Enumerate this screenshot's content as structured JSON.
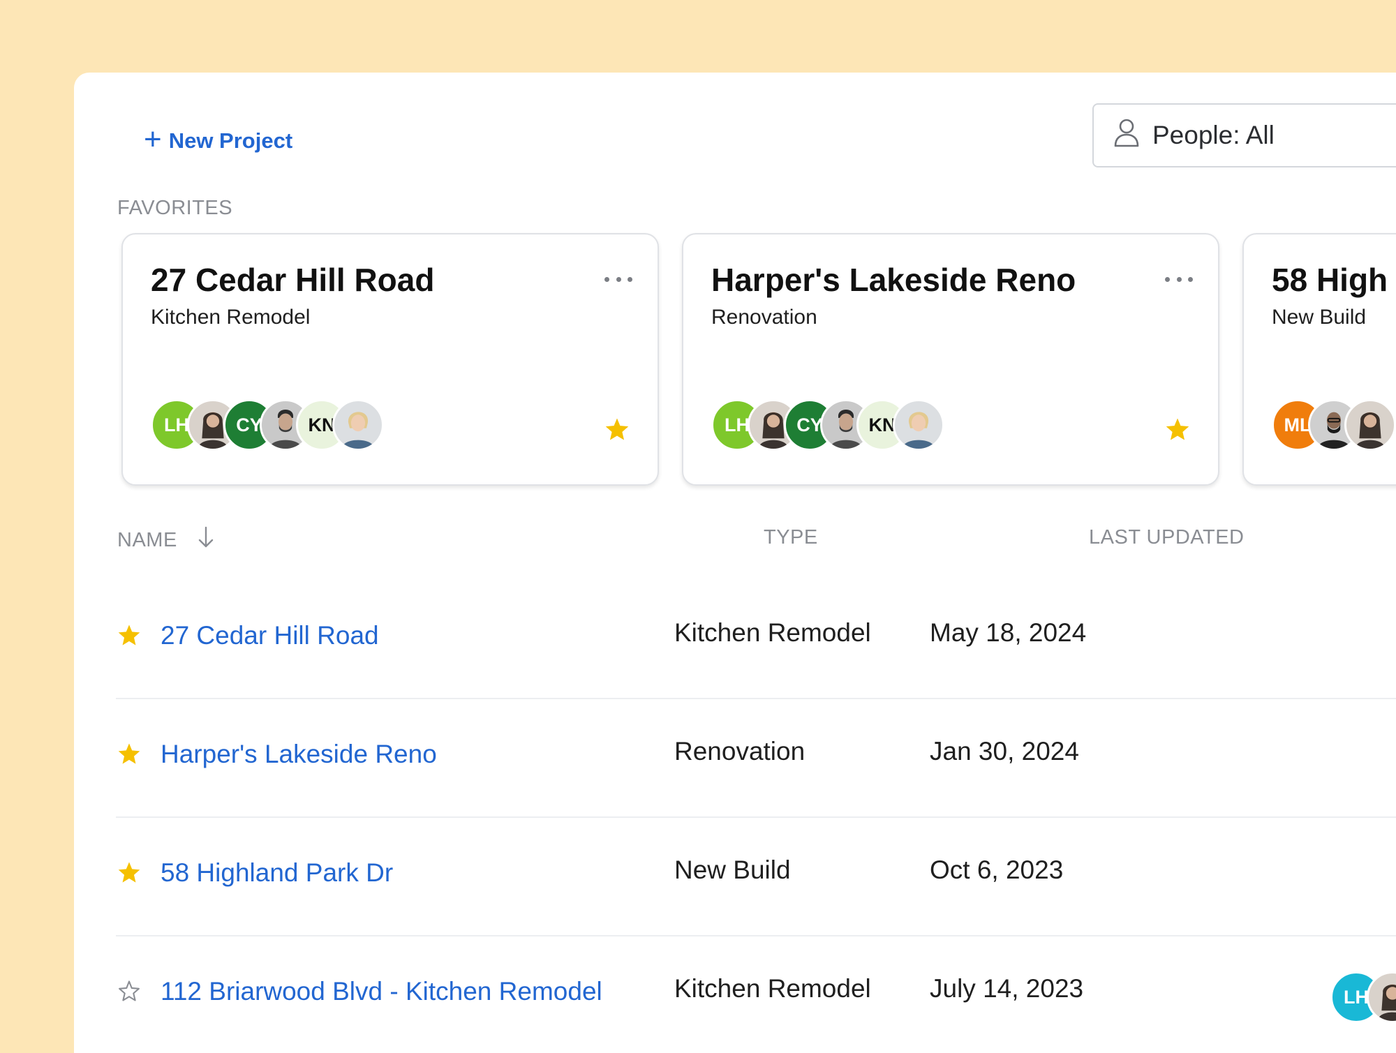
{
  "toolbar": {
    "new_project_label": "New Project",
    "people_filter_label": "People: All"
  },
  "favorites": {
    "section_label": "FAVORITES",
    "cards": [
      {
        "title": "27 Cedar Hill Road",
        "subtitle": "Kitchen Remodel",
        "starred": true,
        "avatars": [
          {
            "initials": "LH",
            "color": "#7ec82b"
          },
          {
            "photo": "woman-dark-hair",
            "color": "#d9d2cb"
          },
          {
            "initials": "CY",
            "color": "#1e7e34"
          },
          {
            "photo": "man-beard",
            "color": "#c9c9c9"
          },
          {
            "initials": "KN",
            "color": "#e9f3dd",
            "text_color": "#111111"
          },
          {
            "photo": "woman-blonde",
            "color": "#dcdfe2"
          }
        ]
      },
      {
        "title": "Harper's Lakeside Reno",
        "subtitle": "Renovation",
        "starred": true,
        "avatars": [
          {
            "initials": "LH",
            "color": "#7ec82b"
          },
          {
            "photo": "woman-dark-hair",
            "color": "#d9d2cb"
          },
          {
            "initials": "CY",
            "color": "#1e7e34"
          },
          {
            "photo": "man-beard",
            "color": "#c9c9c9"
          },
          {
            "initials": "KN",
            "color": "#e9f3dd",
            "text_color": "#111111"
          },
          {
            "photo": "woman-blonde",
            "color": "#dcdfe2"
          }
        ]
      },
      {
        "title": "58 High",
        "subtitle": "New Build",
        "starred": true,
        "avatars": [
          {
            "initials": "ML",
            "color": "#f07d0c"
          },
          {
            "photo": "man-glasses-beard",
            "color": "#cfcfcf"
          },
          {
            "photo": "woman-dark-hair",
            "color": "#d9d2cb"
          }
        ]
      }
    ]
  },
  "table": {
    "columns": {
      "name": "NAME",
      "type": "TYPE",
      "last_updated": "LAST UPDATED"
    },
    "sort": {
      "column": "name",
      "direction": "descending"
    },
    "rows": [
      {
        "name": "27 Cedar Hill Road",
        "type": "Kitchen Remodel",
        "last_updated": "May 18, 2024",
        "starred": true
      },
      {
        "name": "Harper's Lakeside Reno",
        "type": "Renovation",
        "last_updated": "Jan 30, 2024",
        "starred": true
      },
      {
        "name": "58 Highland Park Dr",
        "type": "New Build",
        "last_updated": "Oct 6, 2023",
        "starred": true
      },
      {
        "name": "112 Briarwood Blvd - Kitchen Remodel",
        "type": "Kitchen Remodel",
        "last_updated": "July 14, 2023",
        "starred": false,
        "avatars": [
          {
            "initials": "LH",
            "color": "#19b8d6"
          },
          {
            "photo": "woman-dark-hair",
            "color": "#d9d2cb"
          }
        ]
      }
    ]
  },
  "colors": {
    "accent": "#2266d1",
    "star": "#f5c000",
    "background": "#fde6b6"
  },
  "icons": {
    "new_project": "plus-icon",
    "people_filter": "person-icon",
    "card_menu": "more-horizontal-icon",
    "favorite": "star-icon",
    "sort": "arrow-down-icon"
  }
}
